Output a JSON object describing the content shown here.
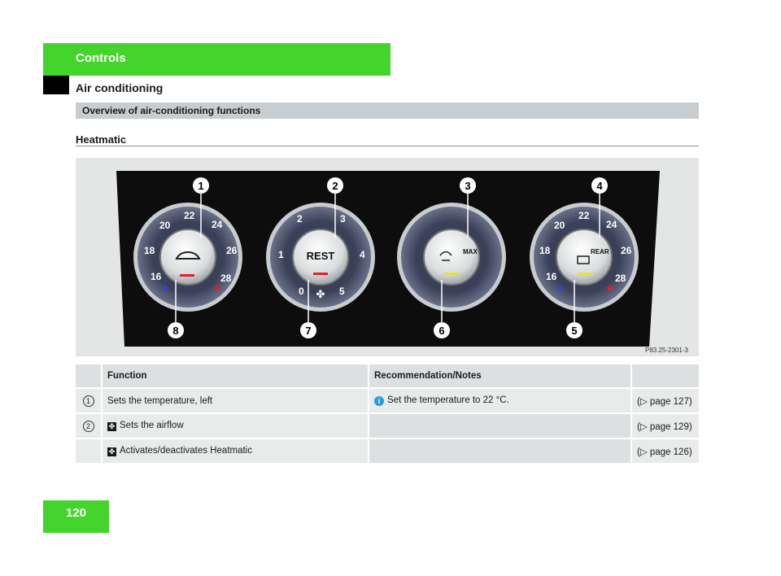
{
  "header": {
    "tab": "Controls",
    "section": "Air conditioning"
  },
  "overview_bar": "Overview of air-conditioning functions",
  "subtitle": "Heatmatic",
  "figure": {
    "code": "P83.25-2301-3",
    "callouts": [
      "1",
      "2",
      "3",
      "4",
      "5",
      "6",
      "7",
      "8"
    ],
    "dials": [
      {
        "center": "",
        "scale": [
          "16",
          "18",
          "20",
          "22",
          "24",
          "26",
          "28"
        ]
      },
      {
        "center": "REST",
        "scale": [
          "0",
          "1",
          "2",
          "3",
          "4",
          "5"
        ]
      },
      {
        "center": "MAX",
        "scale": []
      },
      {
        "center": "REAR",
        "scale": [
          "16",
          "18",
          "20",
          "22",
          "24",
          "26",
          "28"
        ]
      }
    ]
  },
  "table": {
    "headers": [
      "Function",
      "Recommendation/Notes"
    ],
    "rows": [
      {
        "num": "1",
        "func": "Sets the temperature, left",
        "note": "Set the temperature to 22 °C.",
        "ref": "(▷ page 127)"
      },
      {
        "num": "2",
        "func": "Sets the airflow",
        "note": "",
        "ref": "(▷ page 129)"
      },
      {
        "num": "",
        "func": "Activates/deactivates Heatmatic",
        "note": "",
        "ref": "(▷ page 126)"
      }
    ]
  },
  "page_number": "120"
}
